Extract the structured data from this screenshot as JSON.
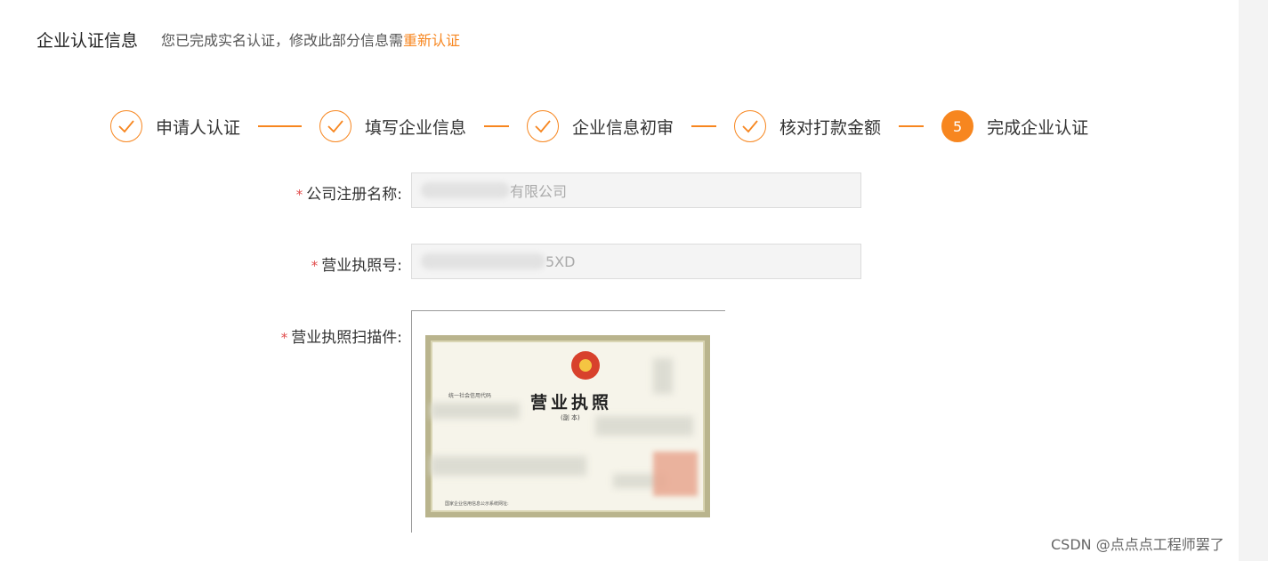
{
  "header": {
    "title": "企业认证信息",
    "notice_prefix": "您已完成实名认证，修改此部分信息需",
    "notice_link": "重新认证"
  },
  "steps": [
    {
      "label": "申请人认证",
      "status": "done"
    },
    {
      "label": "填写企业信息",
      "status": "done"
    },
    {
      "label": "企业信息初审",
      "status": "done"
    },
    {
      "label": "核对打款金额",
      "status": "done"
    },
    {
      "label": "完成企业认证",
      "status": "active",
      "number": "5"
    }
  ],
  "form": {
    "company_name": {
      "label": "公司注册名称:",
      "value_visible": "有限公司"
    },
    "license_no": {
      "label": "营业执照号:",
      "value_visible": "5XD"
    },
    "license_scan": {
      "label": "营业执照扫描件:"
    }
  },
  "certificate": {
    "title": "营业执照",
    "subtitle": "(副 本)",
    "code_label": "统一社会信用代码",
    "foot": "国家企业信用信息公示系统网址:"
  },
  "colors": {
    "accent": "#f7861f",
    "required": "#e14b4b"
  },
  "icons": {
    "done": "check-icon"
  },
  "watermark": "CSDN @点点点工程师罢了"
}
